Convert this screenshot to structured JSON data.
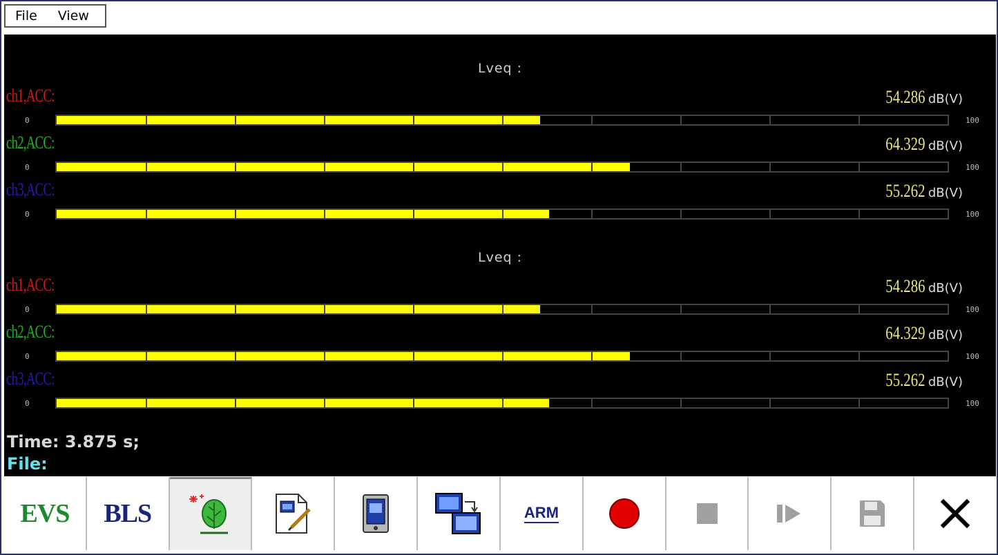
{
  "menu": {
    "items": [
      "File",
      "View"
    ]
  },
  "sections": [
    {
      "title": "Lveq :",
      "channels": [
        {
          "label": "ch1,ACC:",
          "color": "#d11a1a",
          "value": "54.286",
          "unit": "dB(V)",
          "scale_min": "0",
          "scale_max": "100",
          "level_pct": 54.286
        },
        {
          "label": "ch2,ACC:",
          "color": "#1db41d",
          "value": "64.329",
          "unit": "dB(V)",
          "scale_min": "0",
          "scale_max": "100",
          "level_pct": 64.329
        },
        {
          "label": "ch3,ACC:",
          "color": "#1f1fa8",
          "value": "55.262",
          "unit": "dB(V)",
          "scale_min": "0",
          "scale_max": "100",
          "level_pct": 55.262
        }
      ]
    },
    {
      "title": "Lveq :",
      "channels": [
        {
          "label": "ch1,ACC:",
          "color": "#d11a1a",
          "value": "54.286",
          "unit": "dB(V)",
          "scale_min": "0",
          "scale_max": "100",
          "level_pct": 54.286
        },
        {
          "label": "ch2,ACC:",
          "color": "#1db41d",
          "value": "64.329",
          "unit": "dB(V)",
          "scale_min": "0",
          "scale_max": "100",
          "level_pct": 64.329
        },
        {
          "label": "ch3,ACC:",
          "color": "#1f1fa8",
          "value": "55.262",
          "unit": "dB(V)",
          "scale_min": "0",
          "scale_max": "100",
          "level_pct": 55.262
        }
      ]
    }
  ],
  "status": {
    "time_text": "Time: 3.875 s;",
    "file_text": "File:"
  },
  "toolbar": {
    "evs_label": "EVS",
    "bls_label": "BLS",
    "arm_label": "ARM",
    "icons": [
      "spectrum-tree-icon",
      "edit-document-icon",
      "device-icon",
      "display-export-icon",
      "record-icon",
      "stop-icon",
      "play-step-icon",
      "save-icon",
      "close-icon"
    ]
  },
  "colors": {
    "bar_fill": "#ffff00",
    "value_text": "#e6e67a",
    "time_text": "#d8d8d8",
    "file_text": "#66e0ee",
    "record": "#e00000"
  }
}
